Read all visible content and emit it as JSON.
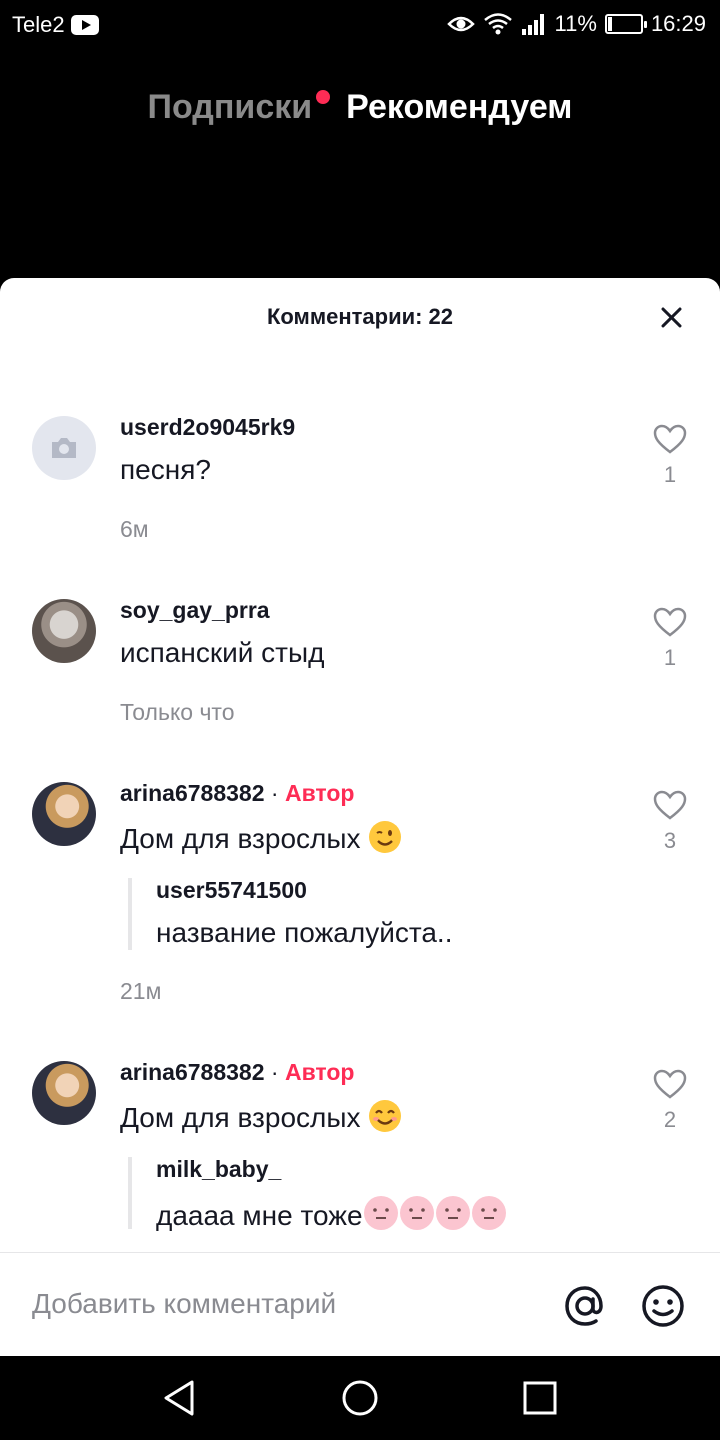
{
  "status_bar": {
    "carrier": "Tele2",
    "battery_text": "11%",
    "battery_level": 0.11,
    "time": "16:29"
  },
  "top_tabs": {
    "following": "Подписки",
    "for_you": "Рекомендуем"
  },
  "comments_sheet": {
    "title": "Комментарии: 22",
    "comments": [
      {
        "username": "userd2o9045rk9",
        "text": "песня?",
        "time": "6м",
        "likes": "1"
      },
      {
        "username": "soy_gay_prra",
        "text": "испанский стыд",
        "time": "Только что",
        "likes": "1"
      },
      {
        "username": "arina6788382",
        "author_separator": "·",
        "author_label": "Автор",
        "text": "Дом для взрослых",
        "emoji": "wink-emoji",
        "likes": "3",
        "reply": {
          "username": "user55741500",
          "text": "название пожалуйста.."
        },
        "time": "21м"
      },
      {
        "username": "arina6788382",
        "author_separator": "·",
        "author_label": "Автор",
        "text": "Дом для взрослых",
        "emoji": "smile-emoji",
        "likes": "2",
        "reply": {
          "username": "milk_baby_",
          "text": "даааа мне тоже",
          "emoji": "pink-face-emoji x4"
        }
      }
    ]
  },
  "input_bar": {
    "placeholder": "Добавить комментарий",
    "mention_icon": "at-icon",
    "emoji_icon": "emoji-icon"
  },
  "colors": {
    "accent": "#fe2c55",
    "text_primary": "#161823",
    "text_secondary": "#8a8b91"
  }
}
